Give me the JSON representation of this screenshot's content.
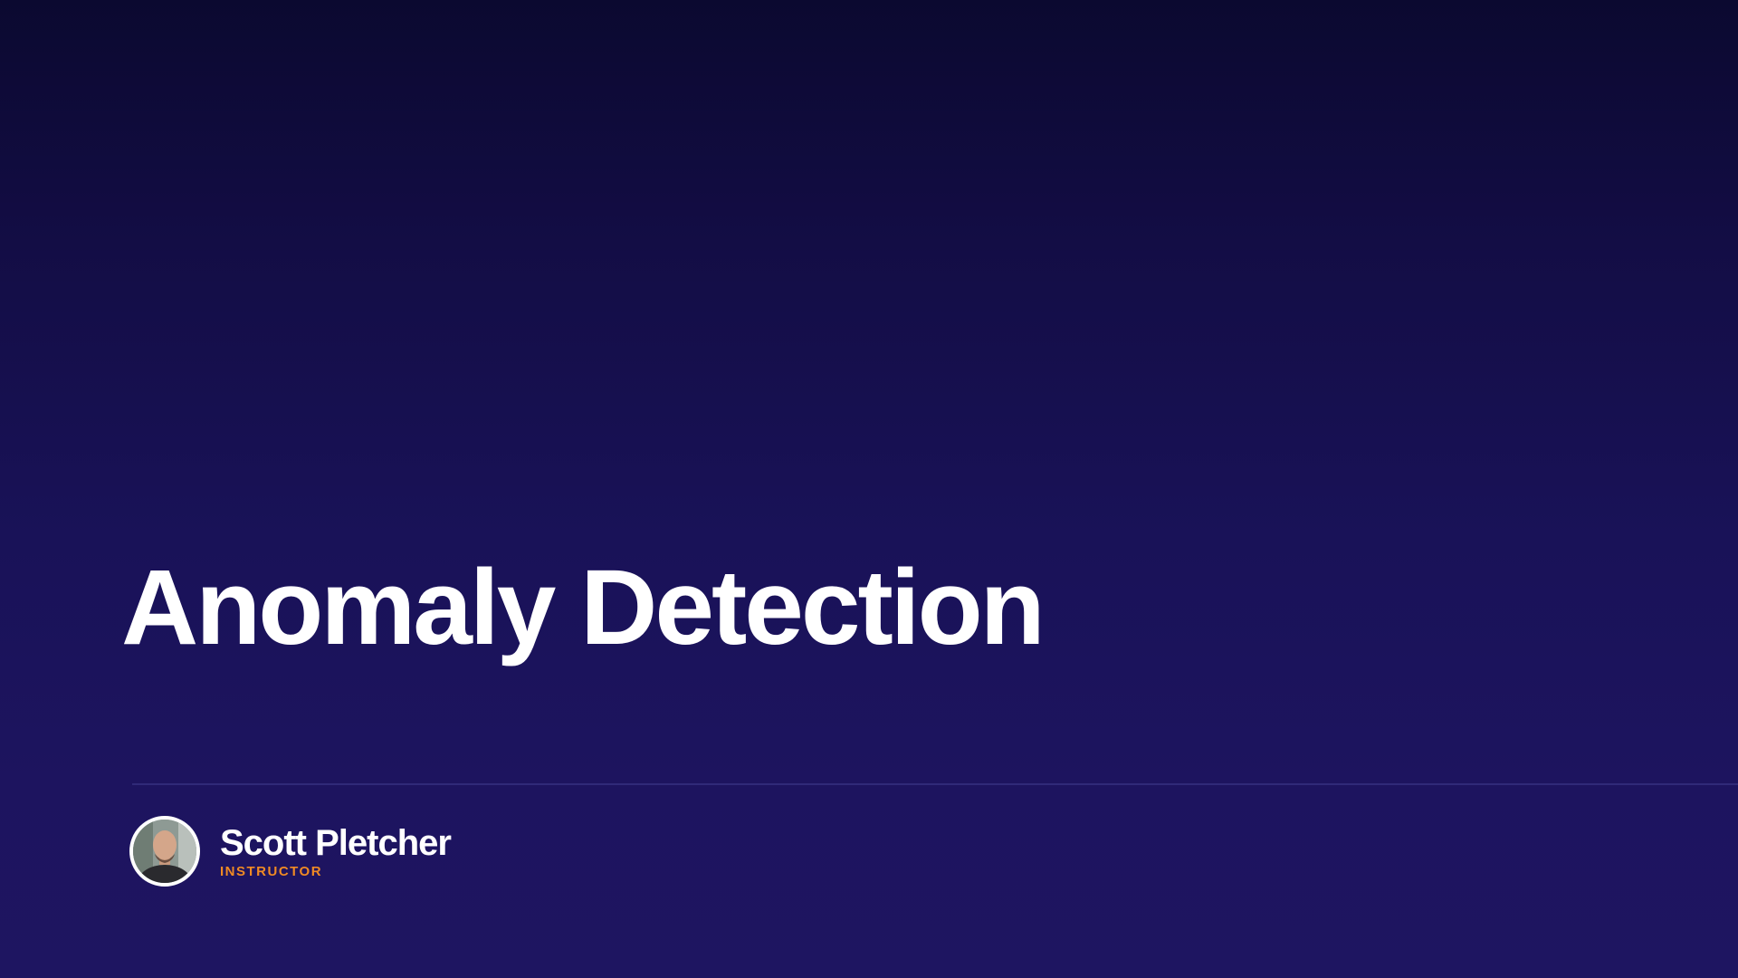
{
  "slide": {
    "title": "Anomaly Detection"
  },
  "presenter": {
    "name": "Scott Pletcher",
    "role": "INSTRUCTOR",
    "avatar_icon": "person-photo-icon"
  },
  "colors": {
    "background_top": "#0b0930",
    "background_bottom": "#1e1561",
    "title_text": "#ffffff",
    "accent": "#f08a24",
    "divider": "#302a78"
  }
}
